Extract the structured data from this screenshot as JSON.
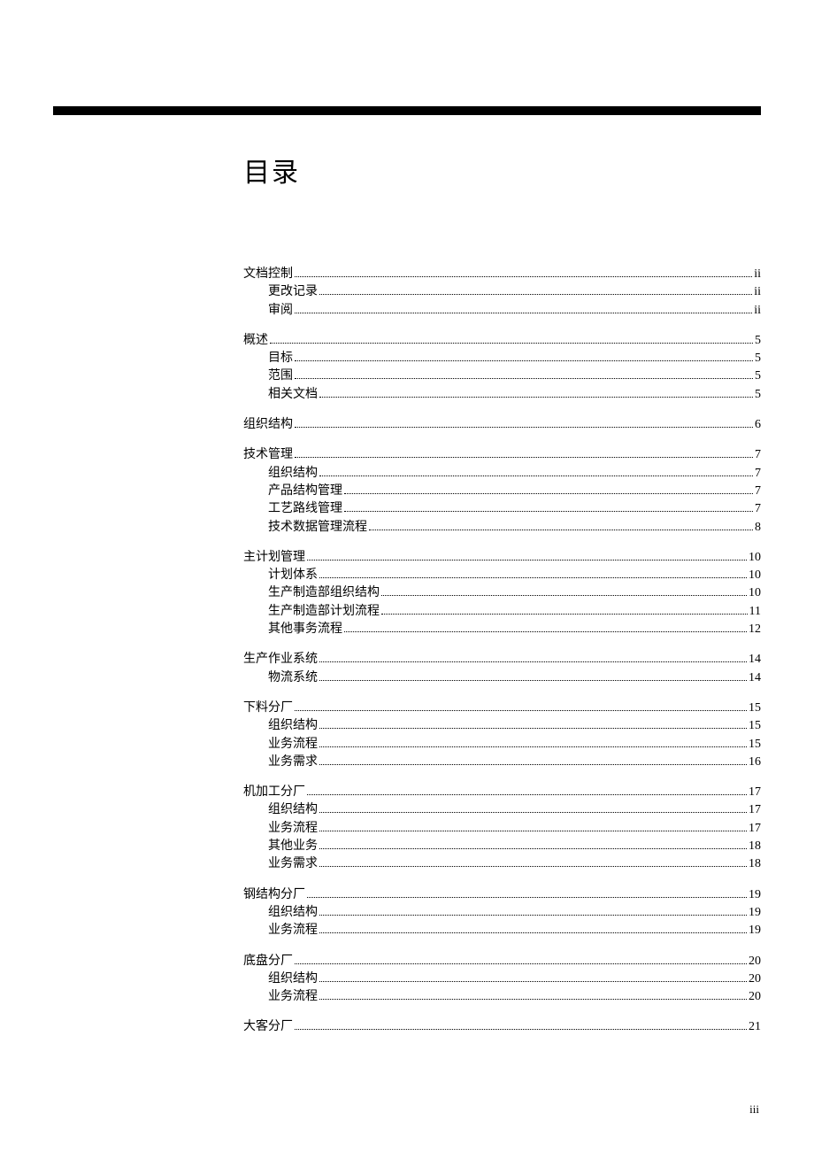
{
  "title": "目录",
  "footer_page": "iii",
  "toc": [
    {
      "label": "文档控制",
      "page": "ii",
      "level": 1
    },
    {
      "label": "更改记录",
      "page": "ii",
      "level": 2
    },
    {
      "label": "审阅",
      "page": "ii",
      "level": 2
    },
    {
      "label": "概述",
      "page": "5",
      "level": 1,
      "gap": true
    },
    {
      "label": "目标",
      "page": "5",
      "level": 2
    },
    {
      "label": "范围",
      "page": "5",
      "level": 2
    },
    {
      "label": "相关文档",
      "page": "5",
      "level": 2
    },
    {
      "label": "组织结构",
      "page": "6",
      "level": 1,
      "gap": true
    },
    {
      "label": "技术管理",
      "page": "7",
      "level": 1,
      "gap": true
    },
    {
      "label": "组织结构",
      "page": "7",
      "level": 2
    },
    {
      "label": "产品结构管理",
      "page": "7",
      "level": 2
    },
    {
      "label": "工艺路线管理",
      "page": "7",
      "level": 2
    },
    {
      "label": "技术数据管理流程",
      "page": "8",
      "level": 2
    },
    {
      "label": "主计划管理",
      "page": "10",
      "level": 1,
      "gap": true
    },
    {
      "label": "计划体系",
      "page": "10",
      "level": 2
    },
    {
      "label": "生产制造部组织结构",
      "page": "10",
      "level": 2
    },
    {
      "label": "生产制造部计划流程",
      "page": "11",
      "level": 2
    },
    {
      "label": "其他事务流程",
      "page": "12",
      "level": 2
    },
    {
      "label": "生产作业系统",
      "page": "14",
      "level": 1,
      "gap": true
    },
    {
      "label": "物流系统",
      "page": "14",
      "level": 2
    },
    {
      "label": "下料分厂",
      "page": "15",
      "level": 1,
      "gap": true
    },
    {
      "label": "组织结构",
      "page": "15",
      "level": 2
    },
    {
      "label": "业务流程",
      "page": "15",
      "level": 2
    },
    {
      "label": "业务需求",
      "page": "16",
      "level": 2
    },
    {
      "label": "机加工分厂",
      "page": "17",
      "level": 1,
      "gap": true
    },
    {
      "label": "组织结构",
      "page": "17",
      "level": 2
    },
    {
      "label": "业务流程",
      "page": "17",
      "level": 2
    },
    {
      "label": "其他业务",
      "page": "18",
      "level": 2
    },
    {
      "label": "业务需求",
      "page": "18",
      "level": 2
    },
    {
      "label": "钢结构分厂",
      "page": "19",
      "level": 1,
      "gap": true
    },
    {
      "label": "组织结构",
      "page": "19",
      "level": 2
    },
    {
      "label": "业务流程",
      "page": "19",
      "level": 2
    },
    {
      "label": "底盘分厂",
      "page": "20",
      "level": 1,
      "gap": true
    },
    {
      "label": "组织结构",
      "page": "20",
      "level": 2
    },
    {
      "label": "业务流程",
      "page": "20",
      "level": 2
    },
    {
      "label": "大客分厂",
      "page": "21",
      "level": 1,
      "gap": true
    }
  ]
}
